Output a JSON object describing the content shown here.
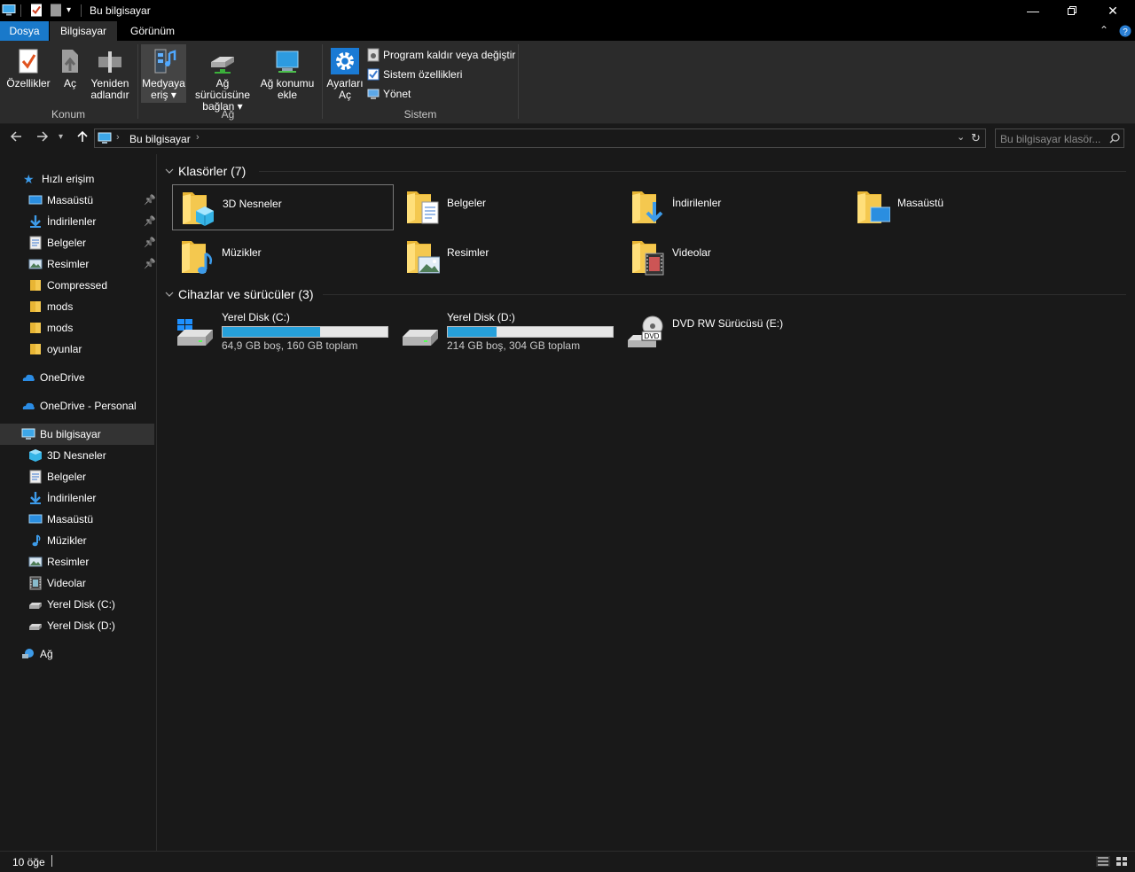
{
  "window": {
    "title": "Bu bilgisayar"
  },
  "ribbon": {
    "tabs": [
      "Dosya",
      "Bilgisayar",
      "Görünüm"
    ],
    "groups": {
      "konum": {
        "label": "Konum",
        "buttons": [
          {
            "label": "Özellikler",
            "icon": "properties-icon"
          },
          {
            "label": "Aç",
            "icon": "open-icon"
          },
          {
            "label1": "Yeniden",
            "label2": "adlandır",
            "icon": "rename-icon"
          }
        ]
      },
      "ag": {
        "label": "Ağ",
        "buttons": [
          {
            "label1": "Medyaya",
            "label2": "eriş",
            "icon": "media-access-icon"
          },
          {
            "label1": "Ağ sürücüsüne",
            "label2": "bağlan",
            "icon": "map-drive-icon"
          },
          {
            "label1": "Ağ konumu",
            "label2": "ekle",
            "icon": "network-location-icon"
          }
        ]
      },
      "sistem": {
        "label": "Sistem",
        "settings": {
          "label1": "Ayarları",
          "label2": "Aç"
        },
        "items": [
          "Program kaldır veya değiştir",
          "Sistem özellikleri",
          "Yönet"
        ]
      }
    }
  },
  "address": {
    "path": "Bu bilgisayar",
    "search_placeholder": "Bu bilgisayar klasör..."
  },
  "sidebar": {
    "quick_access": {
      "label": "Hızlı erişim",
      "items": [
        {
          "label": "Masaüstü",
          "pinned": true,
          "icon": "desktop-icon"
        },
        {
          "label": "İndirilenler",
          "pinned": true,
          "icon": "downloads-icon"
        },
        {
          "label": "Belgeler",
          "pinned": true,
          "icon": "documents-icon"
        },
        {
          "label": "Resimler",
          "pinned": true,
          "icon": "pictures-icon"
        },
        {
          "label": "Compressed",
          "pinned": false,
          "icon": "folder-icon"
        },
        {
          "label": "mods",
          "pinned": false,
          "icon": "folder-icon"
        },
        {
          "label": "mods",
          "pinned": false,
          "icon": "folder-icon"
        },
        {
          "label": "oyunlar",
          "pinned": false,
          "icon": "folder-icon"
        }
      ]
    },
    "onedrive": "OneDrive",
    "onedrive_personal": "OneDrive - Personal",
    "this_pc": {
      "label": "Bu bilgisayar",
      "items": [
        {
          "label": "3D Nesneler",
          "icon": "3d-objects-icon"
        },
        {
          "label": "Belgeler",
          "icon": "documents-icon"
        },
        {
          "label": "İndirilenler",
          "icon": "downloads-icon"
        },
        {
          "label": "Masaüstü",
          "icon": "desktop-icon"
        },
        {
          "label": "Müzikler",
          "icon": "music-icon"
        },
        {
          "label": "Resimler",
          "icon": "pictures-icon"
        },
        {
          "label": "Videolar",
          "icon": "videos-icon"
        },
        {
          "label": "Yerel Disk (C:)",
          "icon": "drive-icon"
        },
        {
          "label": "Yerel Disk (D:)",
          "icon": "drive-icon"
        }
      ]
    },
    "network": "Ağ"
  },
  "content": {
    "folders_header": "Klasörler (7)",
    "folders": [
      {
        "name": "3D Nesneler",
        "overlay": "3d"
      },
      {
        "name": "Belgeler",
        "overlay": "doc"
      },
      {
        "name": "İndirilenler",
        "overlay": "down"
      },
      {
        "name": "Masaüstü",
        "overlay": "desk"
      },
      {
        "name": "Müzikler",
        "overlay": "music"
      },
      {
        "name": "Resimler",
        "overlay": "pic"
      },
      {
        "name": "Videolar",
        "overlay": "video"
      }
    ],
    "devices_header": "Cihazlar ve sürücüler (3)",
    "drives": [
      {
        "name": "Yerel Disk (C:)",
        "free": "64,9 GB boş, 160 GB toplam",
        "used_fraction": 0.594
      },
      {
        "name": "Yerel Disk (D:)",
        "free": "214 GB boş, 304 GB toplam",
        "used_fraction": 0.296
      },
      {
        "name": "DVD RW Sürücüsü (E:)"
      }
    ]
  },
  "status": {
    "count": "10 öğe"
  },
  "colors": {
    "accent": "#1979ca",
    "bar_fill": "#26a0da",
    "folder": "#f4c84f"
  }
}
